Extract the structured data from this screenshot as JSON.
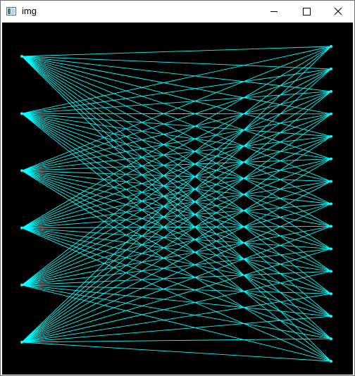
{
  "window": {
    "title": "img",
    "icon": "image-window-icon",
    "controls": {
      "minimize_icon": "minimize-icon",
      "maximize_icon": "maximize-icon",
      "close_icon": "close-icon"
    }
  },
  "canvas": {
    "background_color": "#000000",
    "line_color": "#00ffff",
    "left_node_count": 6,
    "right_node_count": 15
  }
}
